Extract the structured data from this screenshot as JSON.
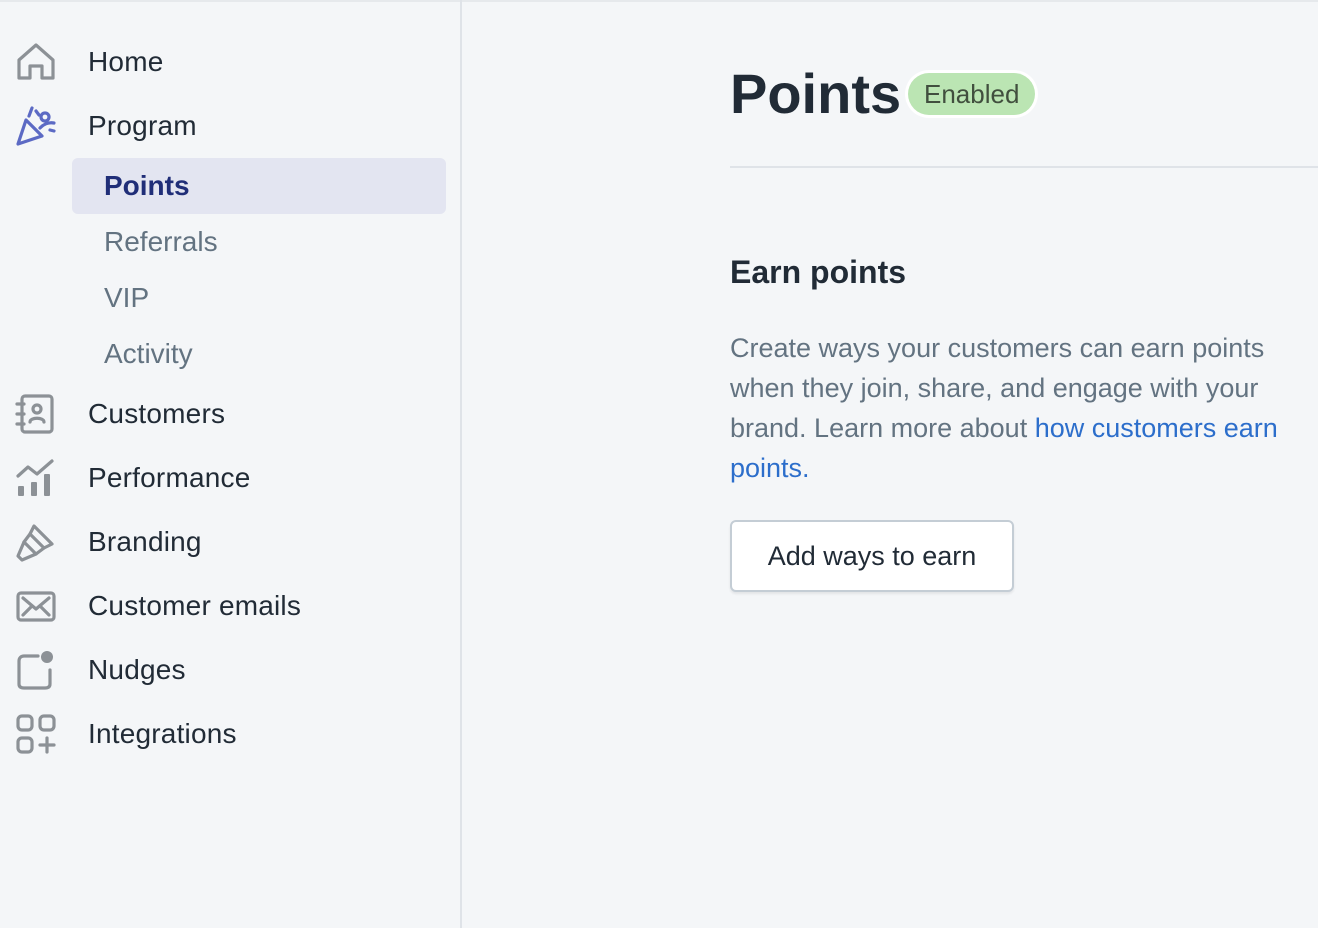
{
  "sidebar": {
    "items": [
      {
        "label": "Home",
        "icon": "home-icon"
      },
      {
        "label": "Program",
        "icon": "party-popper-icon"
      },
      {
        "label": "Customers",
        "icon": "contacts-icon"
      },
      {
        "label": "Performance",
        "icon": "analytics-icon"
      },
      {
        "label": "Branding",
        "icon": "paint-brush-icon"
      },
      {
        "label": "Customer emails",
        "icon": "email-icon"
      },
      {
        "label": "Nudges",
        "icon": "notification-icon"
      },
      {
        "label": "Integrations",
        "icon": "apps-icon"
      }
    ],
    "program_subitems": [
      {
        "label": "Points",
        "active": true
      },
      {
        "label": "Referrals",
        "active": false
      },
      {
        "label": "VIP",
        "active": false
      },
      {
        "label": "Activity",
        "active": false
      }
    ]
  },
  "main": {
    "title": "Points",
    "status_badge": "Enabled",
    "section": {
      "title": "Earn points",
      "description": "Create ways your customers can earn points when they join, share, and engage with your brand. Learn more about ",
      "link_text": "how customers earn points.",
      "button_label": "Add ways to earn"
    }
  },
  "colors": {
    "accent": "#5c6ac4",
    "active_text": "#202e78",
    "active_bg": "#e3e5f1",
    "badge_bg": "#bbe5b3",
    "link": "#2c6ecb",
    "icon": "#8c9196"
  }
}
